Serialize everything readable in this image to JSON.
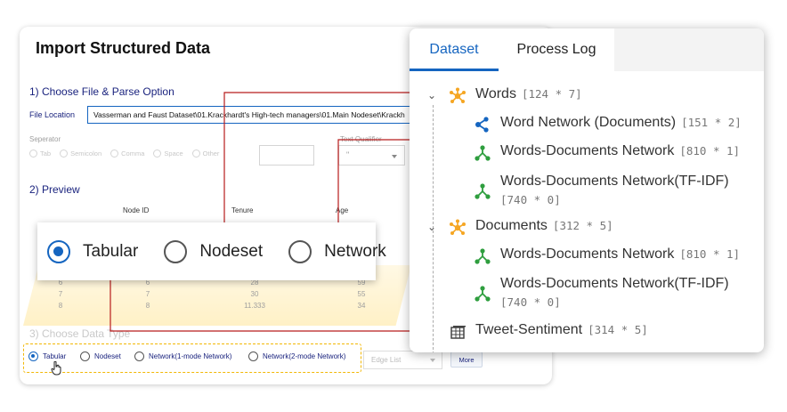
{
  "dialog": {
    "title": "Import Structured Data",
    "section1": "1) Choose File & Parse Option",
    "file_location_label": "File Location",
    "file_location_value": "Vasserman and Faust Dataset\\01.Krackhardt's High-tech managers\\01.Main Nodeset\\Krackh",
    "separator_label": "Seperator",
    "separator_options": [
      "Tab",
      "Semicolon",
      "Comma",
      "Space",
      "Other"
    ],
    "text_qualifier_label": "Text Qualifier",
    "text_qualifier_value": "\"",
    "section2": "2) Preview",
    "preview_headers": [
      "Node ID",
      "Tenure",
      "Age"
    ],
    "preview_rows": [
      [
        "6",
        "6",
        "28",
        "59"
      ],
      [
        "7",
        "7",
        "30",
        "55"
      ],
      [
        "8",
        "8",
        "11.333",
        "34"
      ]
    ],
    "section3": "3) Choose Data Type",
    "data_types": [
      "Tabular",
      "Nodeset",
      "Network(1-mode Network)",
      "Network(2-mode Network)"
    ],
    "edge_list_placeholder": "Edge List",
    "more_label": "More"
  },
  "zoom_callout": {
    "options": [
      "Tabular",
      "Nodeset",
      "Network"
    ],
    "selected": "Tabular"
  },
  "panel": {
    "tabs": [
      "Dataset",
      "Process Log"
    ],
    "active_tab": "Dataset",
    "words": {
      "name": "Words",
      "dim": "[124 * 7]"
    },
    "words_children": [
      {
        "name": "Word Network (Documents)",
        "dim": "[151 * 2]",
        "icon": "network-share-icon"
      },
      {
        "name": "Words-Documents Network",
        "dim": "[810 * 1]",
        "icon": "network-tree-icon"
      },
      {
        "name": "Words-Documents Network(TF-IDF)",
        "dim": "[740 * 0]",
        "icon": "network-tree-icon"
      }
    ],
    "documents": {
      "name": "Documents",
      "dim": "[312 * 5]"
    },
    "documents_children": [
      {
        "name": "Words-Documents Network",
        "dim": "[810 * 1]",
        "icon": "network-tree-icon"
      },
      {
        "name": "Words-Documents Network(TF-IDF)",
        "dim": "[740 * 0]",
        "icon": "network-tree-icon"
      }
    ],
    "tweet": {
      "name": "Tweet-Sentiment",
      "dim": "[314 * 5]"
    }
  },
  "colors": {
    "accent": "#1565c0",
    "connector": "#b71c1c",
    "highlight": "#f2b705",
    "node_orange": "#f5a623",
    "node_green": "#2e9e3e"
  }
}
